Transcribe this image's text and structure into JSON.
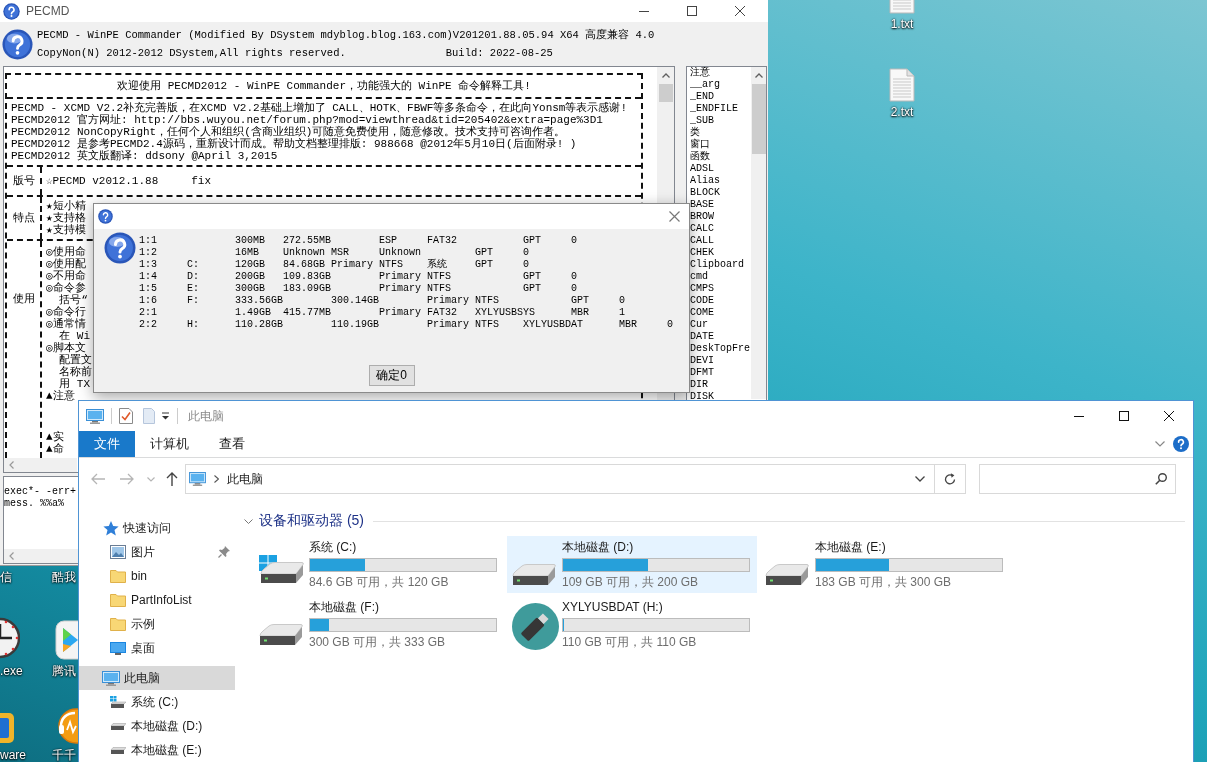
{
  "pecmd_window": {
    "title": "PECMD",
    "header_line": "PECMD - WinPE Commander (Modified By DSystem mdyblog.blog.163.com)V201201.88.05.94 X64 高度兼容 4.0",
    "copyright": "CopyNon(N) 2012-2012 DSystem,All rights reserved.",
    "build": "Build: 2022-08-25",
    "help": {
      "welcome": "欢迎使用 PECMD2012 - WinPE Commander，功能强大的 WinPE 命令解释工具!",
      "intro_lines": [
        "PECMD - XCMD V2.2补充完善版，在XCMD V2.2基础上增加了 CALL、HOTK、FBWF等多条命令，在此向Yonsm等表示感谢!",
        "PECMD2012 官方网址: http://bbs.wuyou.net/forum.php?mod=viewthread&tid=205402&extra=page%3D1",
        "PECMD2012 NonCopyRight，任何个人和组织(含商业组织)可随意免费使用，随意修改。技术支持可咨询作者。",
        "PECMD2012 是参考PECMD2.4源码，重新设计而成。帮助文档整理排版: 988668 @2012年5月10日(后面附录! )",
        "PECMD2012 英文版翻译: ddsony @April 3,2015"
      ],
      "sections": [
        {
          "label": "版号",
          "lines": [
            "☆PECMD v2012.1.88     fix"
          ]
        },
        {
          "label": "特点",
          "lines": [
            "★短小精",
            "★支持格",
            "★支持模"
          ]
        },
        {
          "label": "使用",
          "lines": [
            "◎使用命",
            "◎使用配",
            "◎不用命",
            "◎命令参",
            "  括号“",
            "◎命令行",
            "◎通常情",
            "  在 Wi",
            "◎脚本文",
            "  配置文",
            "  名称前",
            "  用 TX",
            "▲注意"
          ],
          "later_lines": [
            "▲实",
            "▲命"
          ]
        }
      ]
    },
    "commands": [
      "注意",
      "__arg",
      "_END",
      "_ENDFILE",
      "_SUB",
      "类",
      "窗口",
      "函数",
      "ADSL",
      "Alias",
      "BLOCK",
      "BASE",
      "BROW",
      "CALC",
      "CALL",
      "CHEK",
      "Clipboard",
      "cmd",
      "CMPS",
      "CODE",
      "COME",
      "Cur",
      "DATE",
      "DeskTopFre",
      "DEVI",
      "DFMT",
      "DIR",
      "DISK"
    ],
    "log_lines": [
      "exec*- -err+",
      "mess. %%a%"
    ]
  },
  "message_dialog": {
    "lines": [
      "1:1\t\t300MB\t272.55MB\tESP\tFAT32\t\tGPT\t0",
      "1:2\t\t16MB\tUnknown MSR\tUnknown\t\tGPT\t0",
      "1:3\tC:\t120GB\t84.68GB Primary\tNTFS\t系统\tGPT\t0",
      "1:4\tD:\t200GB\t109.83GB\tPrimary\tNTFS\t\tGPT\t0",
      "1:5\tE:\t300GB\t183.09GB\tPrimary\tNTFS\t\tGPT\t0",
      "1:6\tF:\t333.56GB\t300.14GB\tPrimary\tNTFS\t\tGPT\t0",
      "2:1\t\t1.49GB\t415.77MB\tPrimary\tFAT32\tXYLYUSBSYS\tMBR\t1",
      "2:2\tH:\t110.28GB\t110.19GB\tPrimary\tNTFS\tXYLYUSBDAT\tMBR\t0"
    ],
    "ok_button": "确定0"
  },
  "explorer_window": {
    "title": "此电脑",
    "file_tab": "文件",
    "ribbon_tabs": [
      "计算机",
      "查看"
    ],
    "address_path": "此电脑",
    "nav": [
      {
        "label": "快速访问",
        "kind": "quick_access",
        "selected": false,
        "children": [
          {
            "label": "图片",
            "kind": "pictures",
            "pinned": true,
            "selected": false
          },
          {
            "label": "bin",
            "kind": "folder",
            "pinned": false,
            "selected": false
          },
          {
            "label": "PartInfoList",
            "kind": "folder",
            "pinned": false,
            "selected": false
          },
          {
            "label": "示例",
            "kind": "folder",
            "pinned": false,
            "selected": false
          },
          {
            "label": "桌面",
            "kind": "desktop",
            "pinned": false,
            "selected": false
          }
        ]
      },
      {
        "label": "此电脑",
        "kind": "computer",
        "selected": true,
        "children": [
          {
            "label": "系统 (C:)",
            "kind": "system_drive",
            "pinned": false,
            "selected": false
          },
          {
            "label": "本地磁盘 (D:)",
            "kind": "drive",
            "pinned": false,
            "selected": false
          },
          {
            "label": "本地磁盘 (E:)",
            "kind": "drive",
            "pinned": false,
            "selected": false
          }
        ]
      }
    ],
    "group": {
      "title": "设备和驱动器 (5)",
      "expanded": true
    },
    "drives": [
      {
        "name": "系统 (C:)",
        "kind": "system",
        "selected": false,
        "level": 0.295,
        "caption": "84.6 GB 可用，共 120 GB"
      },
      {
        "name": "本地磁盘 (D:)",
        "kind": "hdd",
        "selected": true,
        "level": 0.455,
        "caption": "109 GB 可用，共 200 GB"
      },
      {
        "name": "本地磁盘 (E:)",
        "kind": "hdd",
        "selected": false,
        "level": 0.39,
        "caption": "183 GB 可用，共 300 GB"
      },
      {
        "name": "本地磁盘 (F:)",
        "kind": "hdd",
        "selected": false,
        "level": 0.1,
        "caption": "300 GB 可用，共 333 GB"
      },
      {
        "name": "XYLYUSBDAT (H:)",
        "kind": "usb",
        "selected": false,
        "level": 0.005,
        "caption": "110 GB 可用，共 110 GB"
      }
    ]
  },
  "desktop": {
    "file_icons": [
      {
        "label": "1.txt"
      },
      {
        "label": "2.txt"
      }
    ],
    "edge_icons": [
      {
        "kind": "label_only",
        "label": "信"
      },
      {
        "kind": "label_only",
        "label": "酷我"
      },
      {
        "kind": "clock",
        "label": ".exe"
      },
      {
        "kind": "video",
        "label": "腾讯"
      },
      {
        "kind": "app",
        "label": "ware"
      },
      {
        "kind": "music",
        "label": "千千"
      }
    ]
  }
}
